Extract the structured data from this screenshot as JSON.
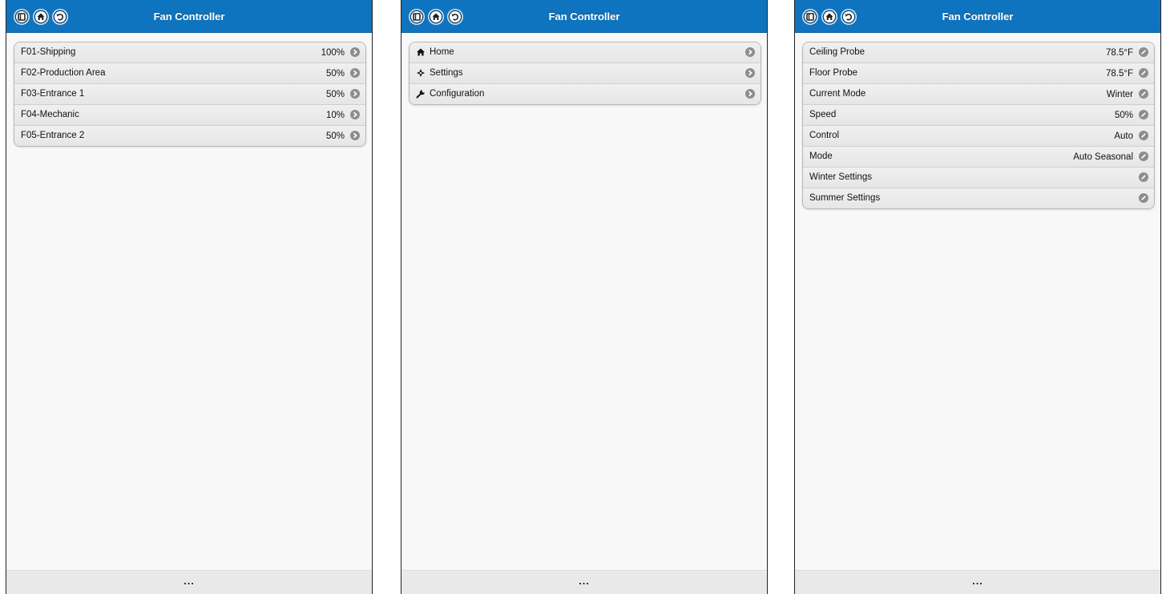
{
  "app": {
    "title": "Fan Controller",
    "footer_text": "..."
  },
  "fans_panel": {
    "rows": [
      {
        "label": "F01-Shipping",
        "value": "100%"
      },
      {
        "label": "F02-Production Area",
        "value": "50%"
      },
      {
        "label": "F03-Entrance 1",
        "value": "50%"
      },
      {
        "label": "F04-Mechanic",
        "value": "10%"
      },
      {
        "label": "F05-Entrance 2",
        "value": "50%"
      }
    ]
  },
  "menu_panel": {
    "rows": [
      {
        "label": "Home",
        "icon": "home-icon"
      },
      {
        "label": "Settings",
        "icon": "settings-icon"
      },
      {
        "label": "Configuration",
        "icon": "wrench-icon"
      }
    ]
  },
  "detail_panel": {
    "rows": [
      {
        "label": "Ceiling Probe",
        "value": "78.5°F"
      },
      {
        "label": "Floor Probe",
        "value": "78.5°F"
      },
      {
        "label": "Current Mode",
        "value": "Winter"
      },
      {
        "label": "Speed",
        "value": "50%"
      },
      {
        "label": "Control",
        "value": "Auto"
      },
      {
        "label": "Mode",
        "value": "Auto Seasonal"
      },
      {
        "label": "Winter Settings",
        "value": ""
      },
      {
        "label": "Summer Settings",
        "value": ""
      }
    ]
  },
  "colors": {
    "header": "#0f74bf",
    "background": "#f8f8f8",
    "footer": "#e9e9e9",
    "row_icon": "#8d8d8d"
  }
}
